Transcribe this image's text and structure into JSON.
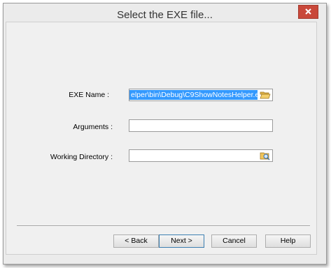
{
  "window": {
    "title": "Select the EXE file..."
  },
  "fields": {
    "exe_name": {
      "label": "EXE Name :",
      "value": "elper\\bin\\Debug\\C9ShowNotesHelper.exe"
    },
    "arguments": {
      "label": "Arguments :",
      "value": ""
    },
    "working_directory": {
      "label": "Working  Directory :",
      "value": ""
    }
  },
  "buttons": {
    "back": "< Back",
    "next": "Next >",
    "cancel": "Cancel",
    "help": "Help"
  },
  "icons": {
    "close": "close-icon",
    "browse_file": "folder-open-icon",
    "browse_dir": "folder-search-icon"
  },
  "colors": {
    "selection": "#3399ff",
    "close_button": "#c9483a"
  }
}
